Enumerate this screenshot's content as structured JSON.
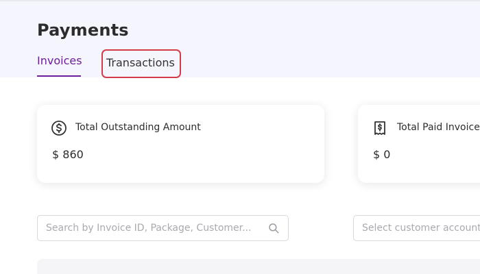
{
  "page": {
    "title": "Payments"
  },
  "tabs": [
    {
      "label": "Invoices",
      "active": true
    },
    {
      "label": "Transactions",
      "active": false,
      "highlighted": true
    }
  ],
  "cards": {
    "outstanding": {
      "icon": "dollar-circle-icon",
      "label": "Total Outstanding Amount",
      "value": "$ 860"
    },
    "paid": {
      "icon": "receipt-icon",
      "label": "Total Paid Invoices",
      "value": "$ 0"
    }
  },
  "filters": {
    "search_placeholder": "Search by Invoice ID, Package, Customer...",
    "search_icon": "search-icon",
    "customer_select_placeholder": "Select customer account"
  },
  "colors": {
    "accent": "#6b1f9a",
    "header_bg": "#f5f5fd",
    "highlight_border": "#d33b49",
    "text": "#2c2c2c"
  }
}
